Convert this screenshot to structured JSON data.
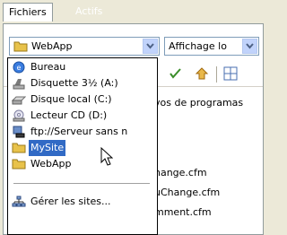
{
  "tabs": [
    {
      "label": "Fichiers"
    },
    {
      "label": "Actifs"
    }
  ],
  "site_combo": {
    "value": "WebApp"
  },
  "view_combo": {
    "value": "Affichage lo"
  },
  "files": [
    {
      "name": "vos de programas"
    },
    {
      "name": "hange.cfm"
    },
    {
      "name": "uChange.cfm"
    },
    {
      "name": "mment.cfm"
    }
  ],
  "dropdown": {
    "items": [
      {
        "label": "Bureau",
        "icon": "desktop-icon"
      },
      {
        "label": "Disquette 3½ (A:)",
        "icon": "floppy-drive-icon"
      },
      {
        "label": "Disque local (C:)",
        "icon": "hard-drive-icon"
      },
      {
        "label": "Lecteur CD (D:)",
        "icon": "cd-drive-icon"
      },
      {
        "label": "ftp://Serveur sans n",
        "icon": "ftp-server-icon"
      },
      {
        "label": "MySite",
        "icon": "folder-icon",
        "selected": true
      },
      {
        "label": "WebApp",
        "icon": "folder-icon"
      }
    ],
    "manage_label": "Gérer les sites..."
  },
  "colors": {
    "selection": "#316ac5",
    "folder": "#e8c24a",
    "panel_bg": "#ece9d8"
  }
}
